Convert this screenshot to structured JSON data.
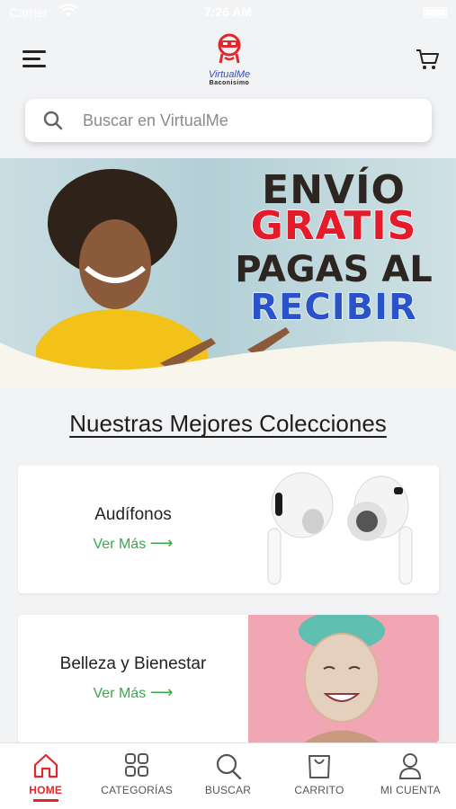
{
  "status_bar": {
    "carrier": "Carrier",
    "time": "7:26 AM"
  },
  "header": {
    "logo_name": "VirtualMe",
    "logo_tagline": "Baconisimo",
    "menu_icon": "hamburger-menu-icon",
    "cart_icon": "cart-icon"
  },
  "search": {
    "placeholder": "Buscar en VirtualMe",
    "value": ""
  },
  "banner": {
    "line1": "ENVÍO",
    "line2": "GRATIS",
    "line3": "PAGAS AL",
    "line4": "RECIBIR"
  },
  "section_title": "Nuestras Mejores Colecciones",
  "collections": [
    {
      "title": "Audífonos",
      "link": "Ver Más",
      "image": "earbuds-image"
    },
    {
      "title": "Belleza y Bienestar",
      "link": "Ver Más",
      "image": "facial-mask-image"
    }
  ],
  "bottom_nav": [
    {
      "label": "HOME",
      "icon": "home-icon",
      "active": true
    },
    {
      "label": "CATEGORÍAS",
      "icon": "grid-icon",
      "active": false
    },
    {
      "label": "BUSCAR",
      "icon": "search-icon",
      "active": false
    },
    {
      "label": "CARRITO",
      "icon": "bag-icon",
      "active": false
    },
    {
      "label": "MI CUENTA",
      "icon": "user-icon",
      "active": false
    }
  ],
  "colors": {
    "accent": "#e4262c",
    "link_green": "#3aa84a",
    "brand_blue": "#3a4bb0"
  }
}
